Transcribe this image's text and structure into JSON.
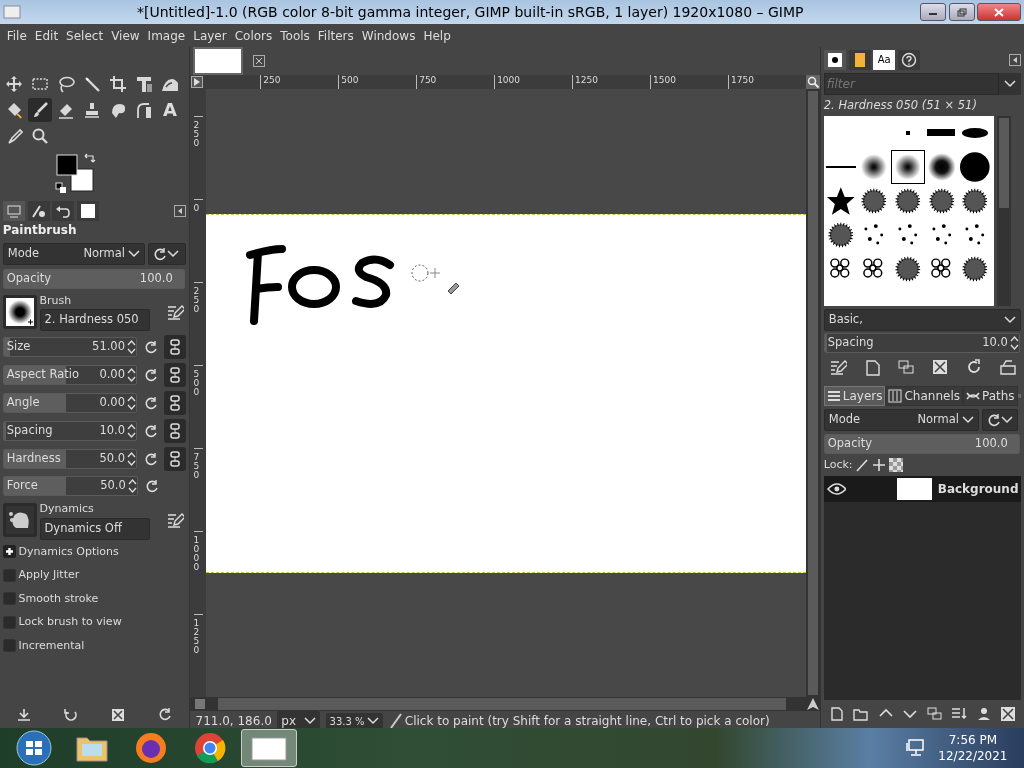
{
  "window": {
    "title": "*[Untitled]-1.0 (RGB color 8-bit gamma integer, GIMP built-in sRGB, 1 layer) 1920x1080 – GIMP"
  },
  "menu": [
    "File",
    "Edit",
    "Select",
    "View",
    "Image",
    "Layer",
    "Colors",
    "Tools",
    "Filters",
    "Windows",
    "Help"
  ],
  "tools": [
    {
      "kind": "move",
      "selected": false
    },
    {
      "kind": "rect-select",
      "selected": false
    },
    {
      "kind": "lasso",
      "selected": false
    },
    {
      "kind": "wand",
      "selected": false
    },
    {
      "kind": "crop",
      "selected": false
    },
    {
      "kind": "transform",
      "selected": false
    },
    {
      "kind": "warp",
      "selected": false
    },
    {
      "kind": "bucket",
      "selected": false
    },
    {
      "kind": "brush",
      "selected": true
    },
    {
      "kind": "eraser",
      "selected": false
    },
    {
      "kind": "stamp",
      "selected": false
    },
    {
      "kind": "smudge",
      "selected": false
    },
    {
      "kind": "pen",
      "selected": false
    },
    {
      "kind": "text",
      "selected": false,
      "glyph": "A"
    },
    {
      "kind": "picker",
      "selected": false
    },
    {
      "kind": "zoom",
      "selected": false
    }
  ],
  "dock_tabs": [
    {
      "kind": "options",
      "selected": true
    },
    {
      "kind": "device",
      "selected": false
    },
    {
      "kind": "undo",
      "selected": false
    },
    {
      "kind": "image",
      "selected": false
    }
  ],
  "tool_options": {
    "title": "Paintbrush",
    "mode": {
      "label": "Mode",
      "value": "Normal"
    },
    "opacity": {
      "label": "Opacity",
      "value": "100.0",
      "level": 1.0
    },
    "brush": {
      "label": "Brush",
      "value": "2. Hardness 050"
    },
    "sliders": [
      {
        "label": "Size",
        "value": "51.00",
        "level": 0.05,
        "chain": true
      },
      {
        "label": "Aspect Ratio",
        "value": "0.00",
        "level": 0.47,
        "chain": true
      },
      {
        "label": "Angle",
        "value": "0.00",
        "level": 0.47,
        "chain": true
      },
      {
        "label": "Spacing",
        "value": "10.0",
        "level": 0.02,
        "chain": true
      },
      {
        "label": "Hardness",
        "value": "50.0",
        "level": 0.47,
        "chain": true
      },
      {
        "label": "Force",
        "value": "50.0",
        "level": 0.47,
        "chain": false
      }
    ],
    "dynamics": {
      "label": "Dynamics",
      "value": "Dynamics Off"
    },
    "dynamics_options": {
      "label": "Dynamics Options",
      "expanded": false
    },
    "checkboxes": [
      {
        "label": "Apply Jitter",
        "checked": false
      },
      {
        "label": "Smooth stroke",
        "checked": false
      },
      {
        "label": "Lock brush to view",
        "checked": false
      },
      {
        "label": "Incremental",
        "checked": false
      }
    ]
  },
  "image_tabs": [
    {
      "selected": true
    }
  ],
  "rulers": {
    "horizontal": [
      "250",
      "500",
      "750",
      "1000",
      "1250",
      "1500",
      "1750"
    ],
    "vertical": [
      "250",
      "0",
      "250",
      "500",
      "750",
      "1000",
      "1250"
    ]
  },
  "status_bar": {
    "coordinates": "711.0, 186.0",
    "unit": "px",
    "zoom": "33.3 %",
    "message": "Click to paint (try Shift for a straight line, Ctrl to pick a color)"
  },
  "brushes_panel": {
    "tabs": [
      {
        "kind": "brushes",
        "selected": true
      },
      {
        "kind": "patterns",
        "selected": false
      },
      {
        "kind": "fonts",
        "glyph": "Aa",
        "selected": false
      },
      {
        "kind": "help",
        "selected": false
      }
    ],
    "filter": {
      "placeholder": "filter"
    },
    "current": "2. Hardness 050 (51 × 51)",
    "brushes": [
      {
        "kind": "blank",
        "selected": false
      },
      {
        "kind": "blank",
        "selected": false
      },
      {
        "kind": "dot",
        "selected": false
      },
      {
        "kind": "bar",
        "selected": false
      },
      {
        "kind": "ellipse",
        "selected": false
      },
      {
        "kind": "line",
        "selected": false
      },
      {
        "kind": "soft",
        "selected": false
      },
      {
        "kind": "soft",
        "selected": true
      },
      {
        "kind": "medium",
        "selected": false
      },
      {
        "kind": "hard",
        "selected": false
      },
      {
        "kind": "star",
        "selected": false
      },
      {
        "kind": "texture",
        "selected": false
      },
      {
        "kind": "texture",
        "selected": false
      },
      {
        "kind": "texture",
        "selected": false
      },
      {
        "kind": "texture",
        "selected": false
      },
      {
        "kind": "texture",
        "selected": false
      },
      {
        "kind": "scatter",
        "selected": false
      },
      {
        "kind": "scatter",
        "selected": false
      },
      {
        "kind": "scatter",
        "selected": false
      },
      {
        "kind": "scatter",
        "selected": false
      },
      {
        "kind": "bubbles",
        "selected": false
      },
      {
        "kind": "bubbles",
        "selected": false
      },
      {
        "kind": "texture",
        "selected": false
      },
      {
        "kind": "bubbles",
        "selected": false
      },
      {
        "kind": "texture",
        "selected": false
      }
    ],
    "tag": "Basic,",
    "spacing": {
      "label": "Spacing",
      "value": "10.0",
      "level": 0.01
    }
  },
  "layers_panel": {
    "tabs": [
      {
        "label": "Layers",
        "kind": "layers",
        "selected": true
      },
      {
        "label": "Channels",
        "kind": "channels",
        "selected": false
      },
      {
        "label": "Paths",
        "kind": "paths",
        "selected": false
      }
    ],
    "mode": {
      "label": "Mode",
      "value": "Normal"
    },
    "opacity": {
      "label": "Opacity",
      "value": "100.0",
      "level": 1.0
    },
    "lock_label": "Lock:",
    "layers": [
      {
        "name": "Background",
        "visible": true,
        "selected": true
      }
    ]
  },
  "taskbar": {
    "apps": [
      {
        "kind": "folder",
        "active": false
      },
      {
        "kind": "firefox",
        "active": false
      },
      {
        "kind": "chrome",
        "active": false
      },
      {
        "kind": "gimp",
        "active": true
      }
    ],
    "time": "7:56 PM",
    "date": "12/22/2021"
  }
}
